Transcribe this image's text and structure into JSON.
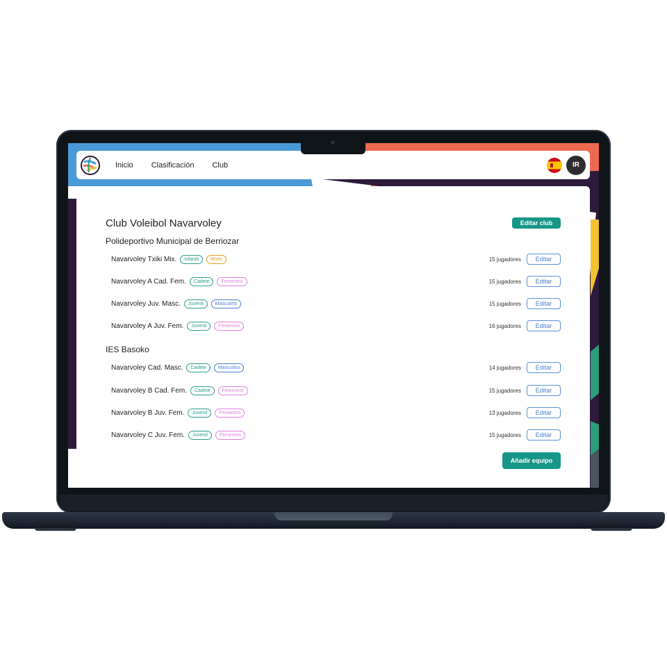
{
  "nav": {
    "links": [
      "Inicio",
      "Clasificación",
      "Club"
    ],
    "avatar_initials": "IR",
    "language_flag": "spain-flag-icon"
  },
  "club": {
    "name": "Club Voleibol Navarvoley",
    "edit_label": "Editar club",
    "add_team_label": "Añadir equipo"
  },
  "venues": [
    {
      "name": "Polideportivo Municipal de Berriozar",
      "teams": [
        {
          "name": "Navarvoley Txiki Mix.",
          "category": "Infantil",
          "gender": "Mixto",
          "players": "15 jugadores",
          "edit_label": "Editar"
        },
        {
          "name": "Navarvoley A Cad. Fem.",
          "category": "Cadete",
          "gender": "Femenino",
          "players": "15 jugadores",
          "edit_label": "Editar"
        },
        {
          "name": "Navarvoley Juv. Masc.",
          "category": "Juvenil",
          "gender": "Masculino",
          "players": "15 jugadores",
          "edit_label": "Editar"
        },
        {
          "name": "Navarvoley A Juv. Fem.",
          "category": "Juvenil",
          "gender": "Femenino",
          "players": "16 jugadores",
          "edit_label": "Editar"
        }
      ]
    },
    {
      "name": "IES Basoko",
      "teams": [
        {
          "name": "Navarvoley Cad. Masc.",
          "category": "Cadete",
          "gender": "Masculino",
          "players": "14 jugadores",
          "edit_label": "Editar"
        },
        {
          "name": "Navarvoley B Cad. Fem.",
          "category": "Cadete",
          "gender": "Femenino",
          "players": "15 jugadores",
          "edit_label": "Editar"
        },
        {
          "name": "Navarvoley B Juv. Fem.",
          "category": "Juvenil",
          "gender": "Femenino",
          "players": "13 jugadores",
          "edit_label": "Editar"
        },
        {
          "name": "Navarvoley C Juv. Fem.",
          "category": "Juvenil",
          "gender": "Femenino",
          "players": "15 jugadores",
          "edit_label": "Editar"
        }
      ]
    }
  ],
  "colors": {
    "primary": "#17968a",
    "edit_button": "#4a7fd0",
    "tag_teal": "#2a9d8f",
    "tag_blue": "#4a7fd0",
    "tag_pink": "#e07ee0",
    "tag_yellow": "#e0a020",
    "bg_blue": "#4a9ad8",
    "bg_orange": "#ee6a4e",
    "bg_purple": "#2e1a3c",
    "bg_yellow": "#f3c130",
    "bg_green": "#2a9d7a"
  }
}
